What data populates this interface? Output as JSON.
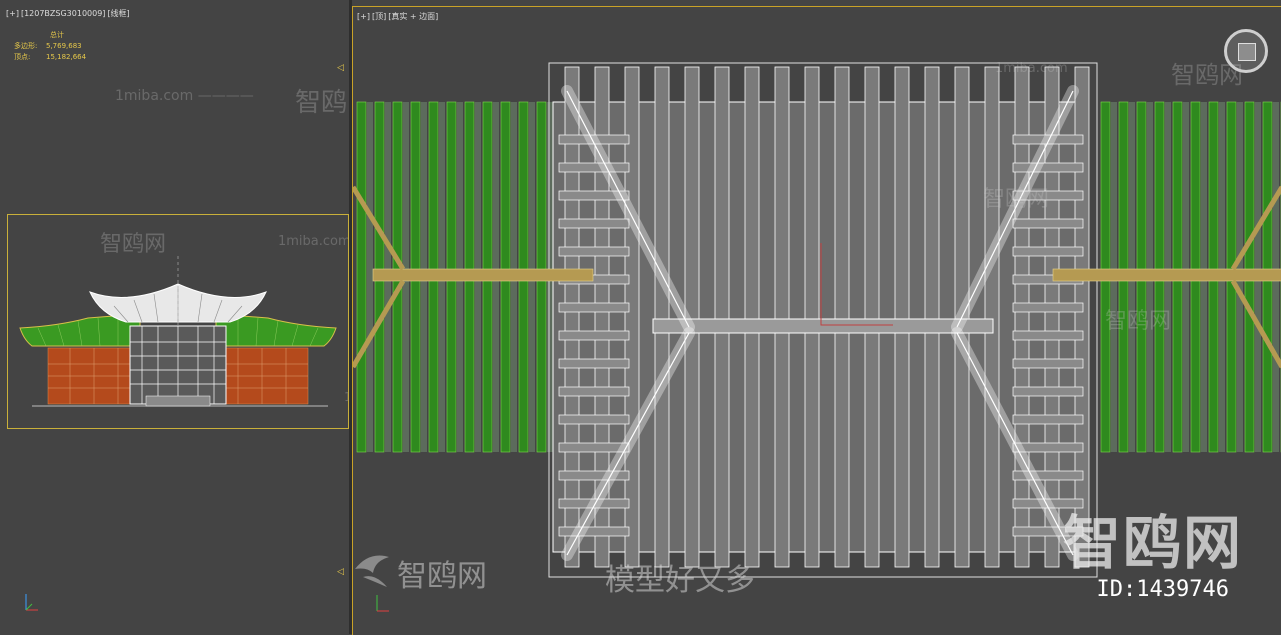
{
  "left_viewport": {
    "labels": [
      "[+]",
      "[1207BZSG3010009]",
      "[线框]"
    ],
    "stats": {
      "header": "总计",
      "polys_label": "多边形:",
      "polys_value": "5,769,683",
      "verts_label": "顶点:",
      "verts_value": "15,182,664"
    }
  },
  "right_viewport": {
    "labels": [
      "[+]",
      "[顶]",
      "[真实 + 边面]"
    ]
  },
  "watermarks": {
    "site": "1miba.com",
    "brand": "智鸥网",
    "slogan": "模型好又多",
    "big": "智鸥网",
    "id": "ID:1439746"
  },
  "colors": {
    "selection": "#c9b03a",
    "stats": "#e6c84a",
    "roof_green": "#2f8a1e",
    "beam": "#b59a52"
  }
}
